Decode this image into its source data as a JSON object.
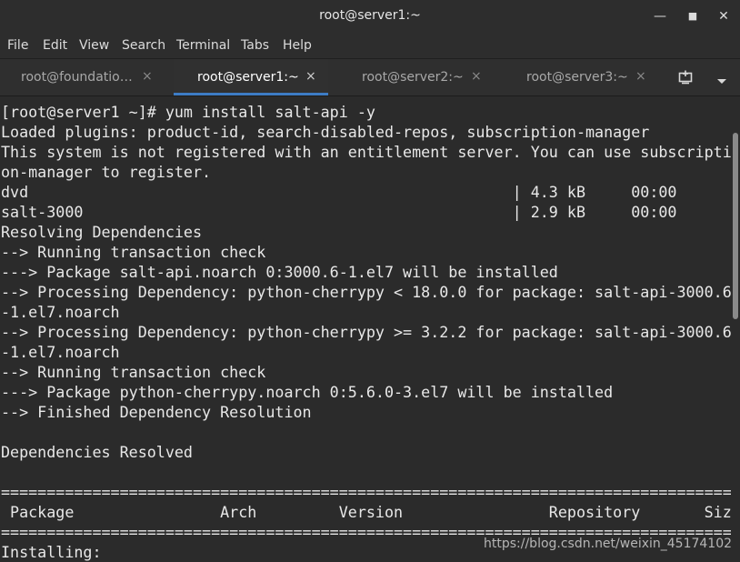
{
  "window": {
    "title": "root@server1:~",
    "minimize_glyph": "—",
    "maximize_glyph": "■",
    "close_glyph": "✕"
  },
  "menu": {
    "items": [
      "File",
      "Edit",
      "View",
      "Search",
      "Terminal",
      "Tabs",
      "Help"
    ]
  },
  "tabs": [
    {
      "label": "root@foundatio…",
      "active": false
    },
    {
      "label": "root@server1:~",
      "active": true
    },
    {
      "label": "root@server2:~",
      "active": false
    },
    {
      "label": "root@server3:~",
      "active": false
    }
  ],
  "tab_close_glyph": "×",
  "icons": {
    "new_tab": "new-tab-icon",
    "tab_menu": "chevron-down-icon"
  },
  "accent_color": "#3d7cc4",
  "terminal": {
    "lines": [
      "[root@server1 ~]# yum install salt-api -y",
      "Loaded plugins: product-id, search-disabled-repos, subscription-manager",
      "This system is not registered with an entitlement server. You can use subscripti",
      "on-manager to register.",
      "dvd                                                     | 4.3 kB     00:00",
      "salt-3000                                               | 2.9 kB     00:00",
      "Resolving Dependencies",
      "--> Running transaction check",
      "---> Package salt-api.noarch 0:3000.6-1.el7 will be installed",
      "--> Processing Dependency: python-cherrypy < 18.0.0 for package: salt-api-3000.6",
      "-1.el7.noarch",
      "--> Processing Dependency: python-cherrypy >= 3.2.2 for package: salt-api-3000.6",
      "-1.el7.noarch",
      "--> Running transaction check",
      "---> Package python-cherrypy.noarch 0:5.6.0-3.el7 will be installed",
      "--> Finished Dependency Resolution",
      "",
      "Dependencies Resolved",
      "",
      "================================================================================",
      " Package                Arch         Version                Repository       Size",
      "================================================================================",
      "Installing:"
    ]
  },
  "watermark": "https://blog.csdn.net/weixin_45174102"
}
